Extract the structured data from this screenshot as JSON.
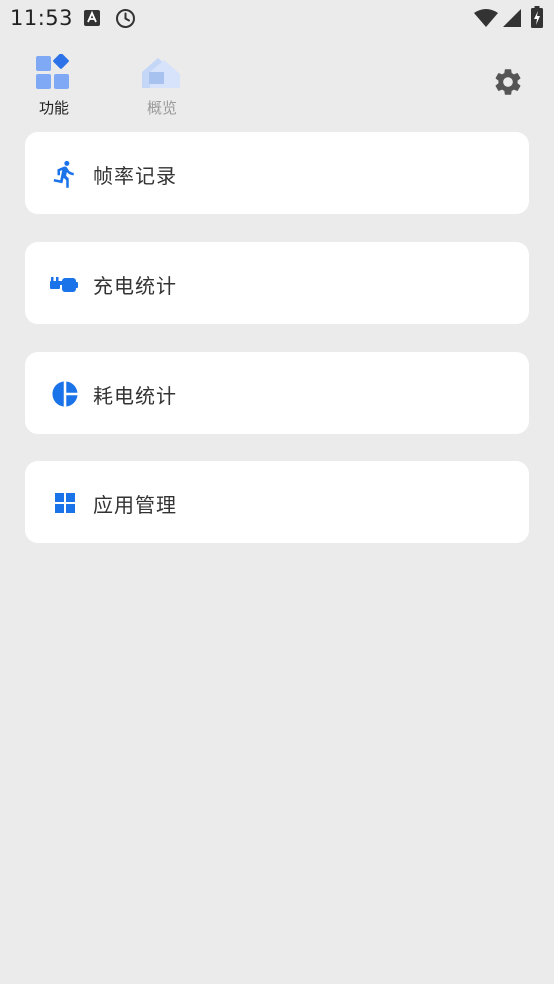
{
  "status_bar": {
    "time": "11:53",
    "icons": [
      "keyboard-a-icon",
      "clock-icon",
      "wifi-icon",
      "signal-icon",
      "battery-charging-icon"
    ]
  },
  "tabs": [
    {
      "label": "功能",
      "icon": "features-grid-icon",
      "active": true
    },
    {
      "label": "概览",
      "icon": "overview-house-icon",
      "active": false
    }
  ],
  "settings": {
    "icon": "gear-icon"
  },
  "menu": [
    {
      "label": "帧率记录",
      "icon": "running-person-icon"
    },
    {
      "label": "充电统计",
      "icon": "charging-plug-icon"
    },
    {
      "label": "耗电统计",
      "icon": "pie-chart-icon"
    },
    {
      "label": "应用管理",
      "icon": "app-grid-icon"
    }
  ],
  "colors": {
    "accent": "#1a73e8",
    "background": "#ebebeb",
    "card": "#ffffff",
    "tab_active": "#222222",
    "tab_inactive": "#9a9a9a"
  }
}
